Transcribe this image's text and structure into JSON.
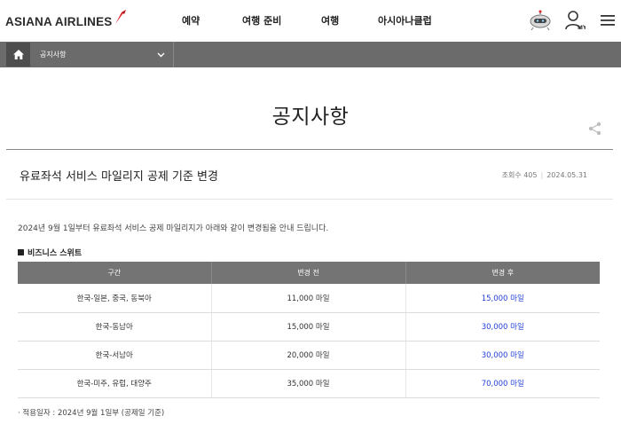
{
  "header": {
    "logo_text": "ASIANA AIRLINES",
    "nav": [
      {
        "label": "예약"
      },
      {
        "label": "여행 준비"
      },
      {
        "label": "여행"
      },
      {
        "label": "아시아나클럽"
      }
    ],
    "icons": [
      "robot-chat-icon",
      "my-account-icon",
      "menu-icon"
    ],
    "my_label": "MY"
  },
  "location": {
    "home_icon": "home-icon",
    "current": "공지사항"
  },
  "page": {
    "title": "공지사항"
  },
  "notice": {
    "title": "유료좌석 서비스 마일리지 공제 기준 변경",
    "views_label": "조회수 405",
    "date": "2024.05.31",
    "intro": "2024년 9월 1일부터 유료좌석 서비스 공제 마일리지가 아래와 같이 변경됨을 안내 드립니다.",
    "section_title": "비즈니스 스위트",
    "table": {
      "headers": [
        "구간",
        "변경 전",
        "변경 후"
      ],
      "rows": [
        [
          "한국-일본, 중국, 동북아",
          "11,000 마일",
          "15,000 마일"
        ],
        [
          "한국-동남아",
          "15,000 마일",
          "30,000 마일"
        ],
        [
          "한국-서남아",
          "20,000 마일",
          "30,000 마일"
        ],
        [
          "한국-미주, 유럽, 대양주",
          "35,000 마일",
          "70,000 마일"
        ]
      ]
    },
    "footnote": "· 적용일자 : 2024년 9월 1일부 (공제일 기준)"
  },
  "colors": {
    "brand_red": "#e0232b",
    "locbar": "#6b6b6b",
    "table_header": "#747474",
    "changed_value": "#1f3fd6"
  }
}
